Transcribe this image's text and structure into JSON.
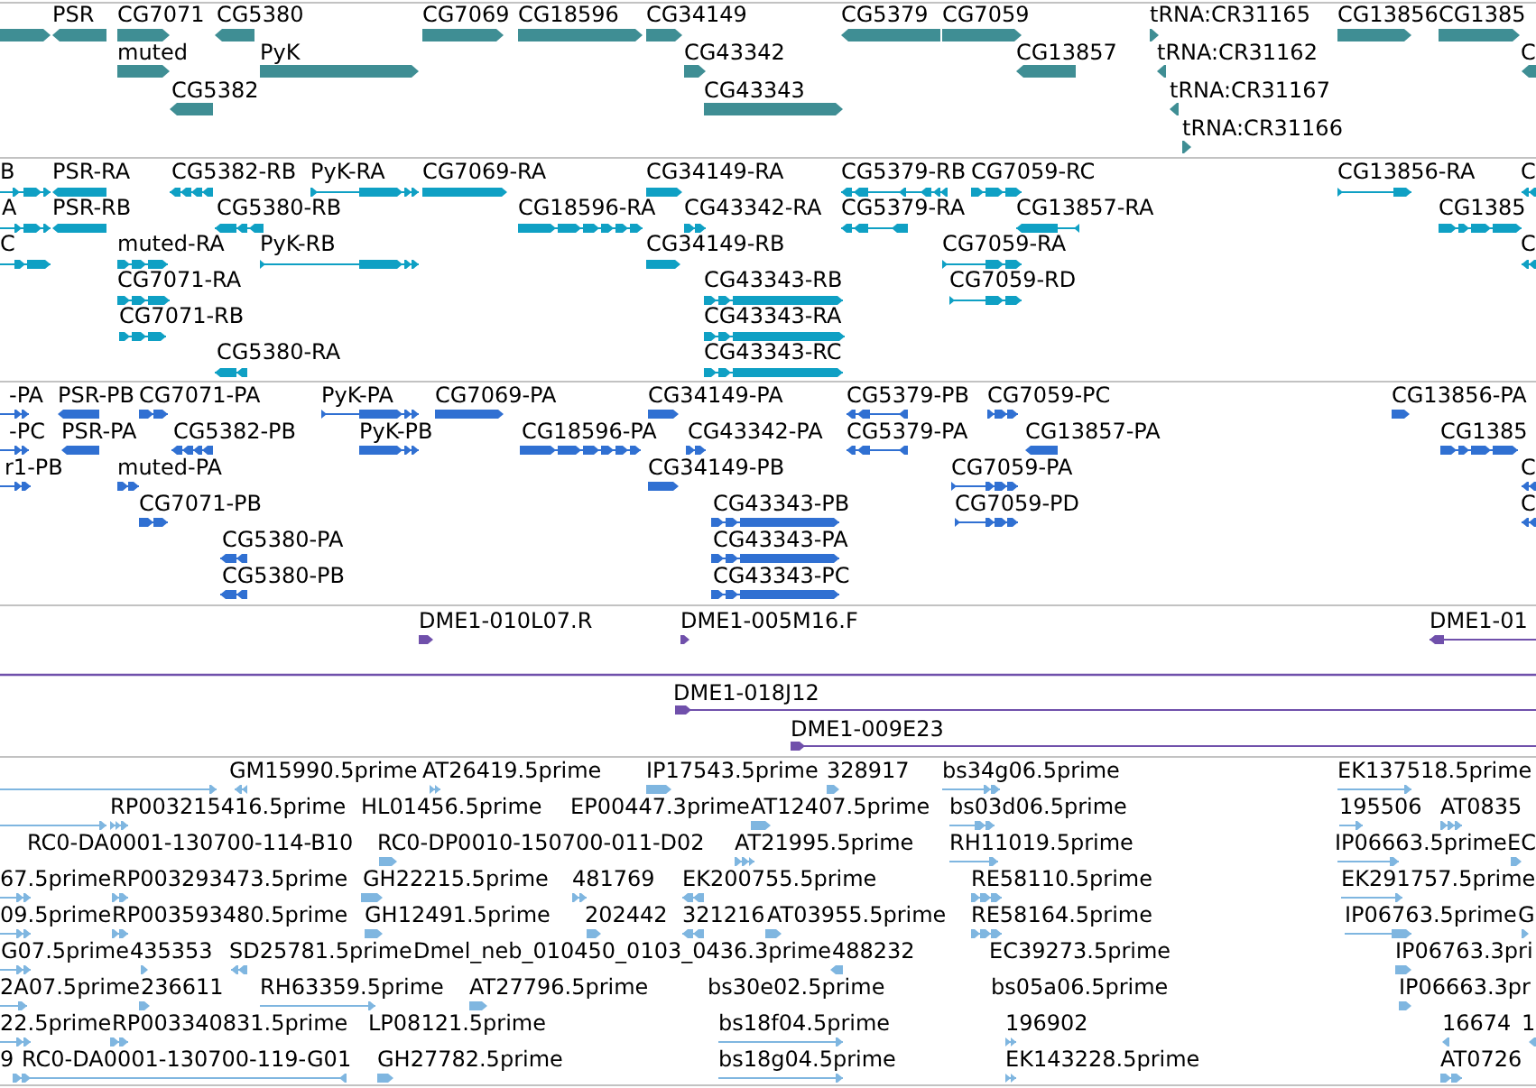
{
  "tracks": [
    {
      "lanes": [
        {
          "features": [
            {
              "reverse": false
            },
            {
              "label": "PSR",
              "reverse": true
            },
            {
              "label": "CG7071",
              "reverse": false
            },
            {
              "label": "CG5380",
              "reverse": true
            },
            {
              "label": "CG7069",
              "reverse": false
            },
            {
              "label": "CG18596",
              "reverse": false
            },
            {
              "label": "CG34149",
              "reverse": false
            },
            {
              "label": "CG5379",
              "reverse": true
            },
            {
              "label": "CG7059",
              "reverse": false
            },
            {
              "label": "tRNA:CR31165",
              "reverse": false
            },
            {
              "label": "CG13856",
              "reverse": false
            },
            {
              "label": "CG1385",
              "reverse": false
            }
          ]
        },
        {
          "features": [
            {
              "label": "muted",
              "reverse": false
            },
            {
              "label": "PyK",
              "reverse": false
            },
            {
              "label": "CG43342",
              "reverse": false
            },
            {
              "label": "CG13857",
              "reverse": true
            },
            {
              "label": "tRNA:CR31162",
              "reverse": true
            },
            {
              "label": "C",
              "reverse": true
            }
          ]
        },
        {
          "features": [
            {
              "label": "CG5382",
              "reverse": true
            },
            {
              "label": "CG43343",
              "reverse": false
            },
            {
              "label": "tRNA:CR31167",
              "reverse": true
            }
          ]
        },
        {
          "features": [
            {
              "label": "tRNA:CR31166",
              "reverse": false
            }
          ]
        }
      ]
    },
    {
      "lanes": [
        {
          "features": [
            {
              "label": "B",
              "reverse": false
            },
            {
              "label": "PSR-RA",
              "reverse": true
            },
            {
              "label": "CG5382-RB",
              "reverse": true
            },
            {
              "label": "PyK-RA",
              "reverse": false
            },
            {
              "label": "CG7069-RA",
              "reverse": false
            },
            {
              "label": "CG34149-RA",
              "reverse": false
            },
            {
              "label": "CG5379-RB",
              "reverse": true
            },
            {
              "label": "CG7059-RC",
              "reverse": false
            },
            {
              "label": "CG13856-RA",
              "reverse": false
            },
            {
              "label": "C",
              "reverse": true
            }
          ]
        },
        {
          "features": [
            {
              "label": "A",
              "reverse": false
            },
            {
              "label": "PSR-RB",
              "reverse": true
            },
            {
              "label": "CG5380-RB",
              "reverse": true
            },
            {
              "label": "CG18596-RA",
              "reverse": false
            },
            {
              "label": "CG43342-RA",
              "reverse": false
            },
            {
              "label": "CG5379-RA",
              "reverse": true
            },
            {
              "label": "CG13857-RA",
              "reverse": true
            },
            {
              "label": "CG1385",
              "reverse": false
            }
          ]
        },
        {
          "features": [
            {
              "label": "C",
              "reverse": false
            },
            {
              "label": "muted-RA",
              "reverse": false
            },
            {
              "label": "PyK-RB",
              "reverse": false
            },
            {
              "label": "CG34149-RB",
              "reverse": false
            },
            {
              "label": "CG7059-RA",
              "reverse": false
            },
            {
              "label": "C",
              "reverse": true
            }
          ]
        },
        {
          "features": [
            {
              "label": "CG7071-RA",
              "reverse": false
            },
            {
              "label": "CG43343-RB",
              "reverse": false
            },
            {
              "label": "CG7059-RD",
              "reverse": false
            }
          ]
        },
        {
          "features": [
            {
              "label": "CG7071-RB",
              "reverse": false
            },
            {
              "label": "CG43343-RA",
              "reverse": false
            }
          ]
        },
        {
          "features": [
            {
              "label": "CG5380-RA",
              "reverse": true
            },
            {
              "label": "CG43343-RC",
              "reverse": false
            }
          ]
        }
      ]
    },
    {
      "lanes": [
        {
          "features": [
            {
              "label": "-PA",
              "reverse": false
            },
            {
              "label": "PSR-PB",
              "reverse": true
            },
            {
              "label": "CG7071-PA",
              "reverse": false
            },
            {
              "label": "PyK-PA",
              "reverse": false
            },
            {
              "label": "CG7069-PA",
              "reverse": false
            },
            {
              "label": "CG34149-PA",
              "reverse": false
            },
            {
              "label": "CG5379-PB",
              "reverse": true
            },
            {
              "label": "CG7059-PC",
              "reverse": false
            },
            {
              "label": "CG13856-PA",
              "reverse": false
            }
          ]
        },
        {
          "features": [
            {
              "label": "-PC",
              "reverse": false
            },
            {
              "label": "PSR-PA",
              "reverse": true
            },
            {
              "label": "CG5382-PB",
              "reverse": true
            },
            {
              "label": "PyK-PB",
              "reverse": false
            },
            {
              "label": "CG18596-PA",
              "reverse": false
            },
            {
              "label": "CG43342-PA",
              "reverse": false
            },
            {
              "label": "CG5379-PA",
              "reverse": true
            },
            {
              "label": "CG13857-PA",
              "reverse": true
            },
            {
              "label": "CG1385",
              "reverse": false
            }
          ]
        },
        {
          "features": [
            {
              "label": "r1-PB",
              "reverse": false
            },
            {
              "label": "muted-PA",
              "reverse": false
            },
            {
              "label": "CG34149-PB",
              "reverse": false
            },
            {
              "label": "CG7059-PA",
              "reverse": false
            },
            {
              "label": "C",
              "reverse": true
            }
          ]
        },
        {
          "features": [
            {
              "label": "CG7071-PB",
              "reverse": false
            },
            {
              "label": "CG43343-PB",
              "reverse": false
            },
            {
              "label": "CG7059-PD",
              "reverse": false
            },
            {
              "label": "C",
              "reverse": true
            }
          ]
        },
        {
          "features": [
            {
              "label": "CG5380-PA",
              "reverse": true
            },
            {
              "label": "CG43343-PA",
              "reverse": false
            }
          ]
        },
        {
          "features": [
            {
              "label": "CG5380-PB",
              "reverse": true
            },
            {
              "label": "CG43343-PC",
              "reverse": false
            }
          ]
        }
      ]
    },
    {
      "lanes": [
        {
          "features": [
            {
              "label": "DME1-010L07.R",
              "reverse": false
            },
            {
              "label": "DME1-005M16.F",
              "reverse": false
            },
            {
              "label": "DME1-01",
              "reverse": true
            }
          ]
        },
        {
          "features": [
            {
              "kind": "line"
            }
          ]
        },
        {
          "features": [
            {
              "label": "DME1-018J12",
              "reverse": false
            }
          ]
        },
        {
          "features": [
            {
              "label": "DME1-009E23",
              "reverse": false
            }
          ]
        }
      ]
    },
    {
      "lanes": [
        {
          "features": [
            {
              "reverse": false
            },
            {
              "label": "GM15990.5prime",
              "reverse": true
            },
            {
              "label": "AT26419.5prime",
              "reverse": false
            },
            {
              "label": "IP17543.5prime",
              "reverse": false
            },
            {
              "label": "328917",
              "reverse": false
            },
            {
              "label": "bs34g06.5prime",
              "reverse": false
            },
            {
              "label": "EK137518.5prime",
              "reverse": false
            }
          ]
        },
        {
          "features": [
            {
              "reverse": false
            },
            {
              "label": "RP003215416.5prime",
              "reverse": false
            },
            {
              "label": "HL01456.5prime"
            },
            {
              "label": "EP00447.3prime"
            },
            {
              "label": "AT12407.5prime",
              "reverse": false
            },
            {
              "label": "bs03d06.5prime",
              "reverse": false
            },
            {
              "label": "195506",
              "reverse": false
            },
            {
              "label": "AT0835",
              "reverse": false
            }
          ]
        },
        {
          "features": [
            {
              "label": "RC0-DA0001-130700-114-B10"
            },
            {
              "label": "RC0-DP0010-150700-011-D02",
              "reverse": false
            },
            {
              "label": "AT21995.5prime",
              "reverse": false
            },
            {
              "label": "RH11019.5prime",
              "reverse": false
            },
            {
              "label": "IP06663.5prime",
              "reverse": false
            },
            {
              "label": "EC",
              "reverse": false
            }
          ]
        },
        {
          "features": [
            {
              "label": "67.5prime",
              "reverse": false
            },
            {
              "label": "RP003293473.5prime",
              "reverse": false
            },
            {
              "label": "GH22215.5prime",
              "reverse": false
            },
            {
              "label": "481769",
              "reverse": false
            },
            {
              "label": "EK200755.5prime",
              "reverse": true
            },
            {
              "label": "RE58110.5prime",
              "reverse": false
            },
            {
              "label": "EK291757.5prime",
              "reverse": false
            }
          ]
        },
        {
          "features": [
            {
              "label": "09.5prime",
              "reverse": false
            },
            {
              "label": "RP003593480.5prime",
              "reverse": false
            },
            {
              "label": "GH12491.5prime",
              "reverse": false
            },
            {
              "label": "202442",
              "reverse": false
            },
            {
              "label": "321216",
              "reverse": true
            },
            {
              "label": "AT03955.5prime",
              "reverse": false
            },
            {
              "label": "RE58164.5prime",
              "reverse": false
            },
            {
              "label": "IP06763.5prime",
              "reverse": false
            },
            {
              "label": "G",
              "reverse": false
            }
          ]
        },
        {
          "features": [
            {
              "label": "G07.5prime",
              "reverse": false
            },
            {
              "label": "435353",
              "reverse": false
            },
            {
              "label": "SD25781.5prime",
              "reverse": true
            },
            {
              "label": "Dmel_neb_010450_0103_0436.3prime"
            },
            {
              "label": "488232",
              "reverse": true
            },
            {
              "label": "EC39273.5prime"
            },
            {
              "label": "IP06763.3pri",
              "reverse": false
            }
          ]
        },
        {
          "features": [
            {
              "label": "2A07.5prime",
              "reverse": false
            },
            {
              "label": "236611",
              "reverse": false
            },
            {
              "label": "RH63359.5prime",
              "reverse": false
            },
            {
              "label": "AT27796.5prime",
              "reverse": false
            },
            {
              "label": "bs30e02.5prime"
            },
            {
              "label": "bs05a06.5prime"
            },
            {
              "label": "IP06663.3pr",
              "reverse": false
            }
          ]
        },
        {
          "features": [
            {
              "label": "22.5prime",
              "reverse": false
            },
            {
              "label": "RP003340831.5prime",
              "reverse": false
            },
            {
              "label": "LP08121.5prime"
            },
            {
              "label": "bs18f04.5prime",
              "reverse": false
            },
            {
              "label": "196902",
              "reverse": false
            },
            {
              "label": "16674",
              "reverse": true
            },
            {
              "label": "1",
              "reverse": true
            }
          ]
        },
        {
          "features": [
            {
              "label": "9",
              "reverse": false
            },
            {
              "label": "RC0-DA0001-130700-119-G01",
              "reverse": true
            },
            {
              "label": "GH27782.5prime",
              "reverse": false
            },
            {
              "label": "bs18g04.5prime",
              "reverse": false
            },
            {
              "label": "EK143228.5prime",
              "reverse": false
            },
            {
              "label": "AT0726",
              "reverse": false
            }
          ]
        }
      ]
    }
  ]
}
